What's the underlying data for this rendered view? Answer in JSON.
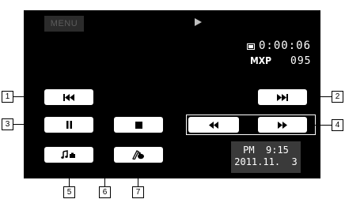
{
  "screen": {
    "menu_label": "MENU",
    "play_indicator_icon": "play-triangle-icon",
    "time_code": "0:00:06",
    "time_icon": "card-icon",
    "mode": "MXP",
    "scene_number": "095",
    "datetime": {
      "time": "PM  9:15",
      "date": "2011.11.  3"
    }
  },
  "buttons": {
    "skip_back": "skip-back-icon",
    "skip_forward": "skip-forward-icon",
    "pause": "pause-icon",
    "stop": "stop-icon",
    "rewind": "rewind-icon",
    "fast_forward": "fast-forward-icon",
    "music_mix": "music-mix-icon",
    "decoration": "decoration-icon"
  },
  "callouts": [
    "1",
    "2",
    "3",
    "4",
    "5",
    "6",
    "7"
  ]
}
